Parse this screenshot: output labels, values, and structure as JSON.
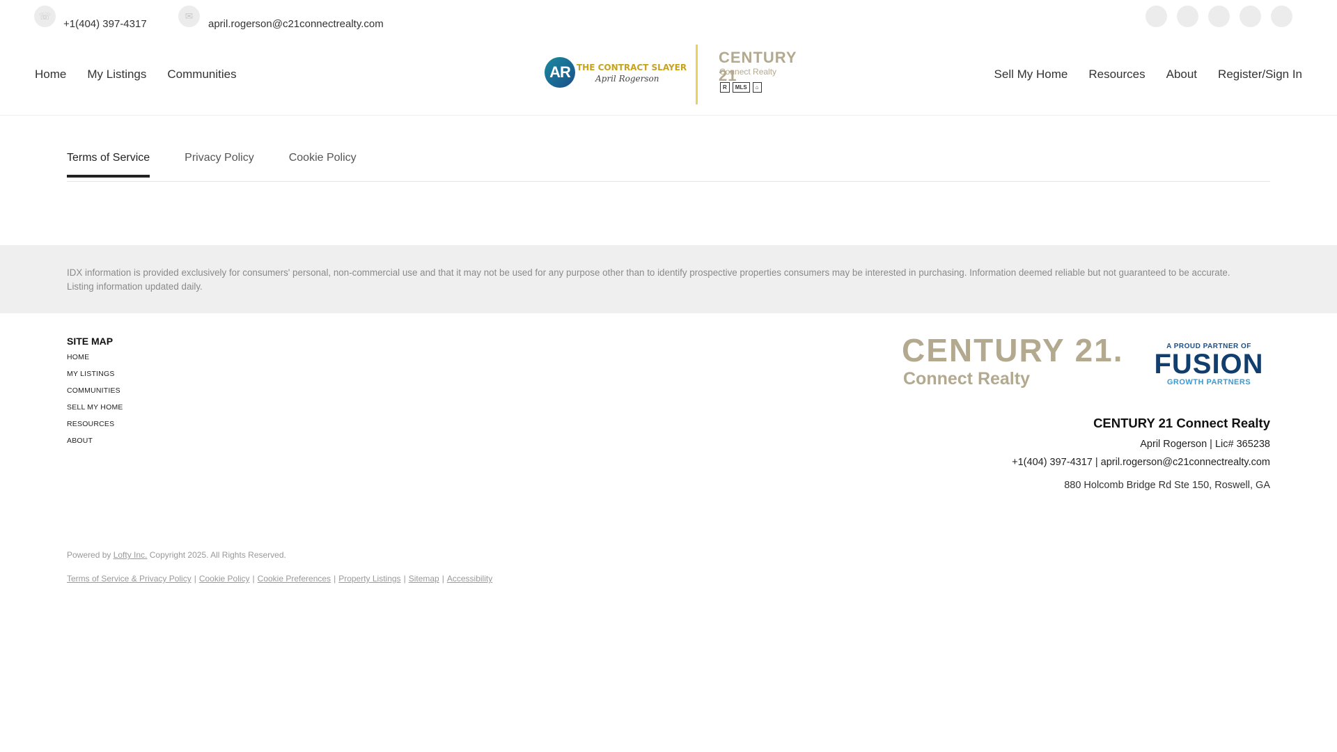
{
  "contact": {
    "phone": "+1(404) 397-4317",
    "email": "april.rogerson@c21connectrealty.com"
  },
  "social_icons": [
    "facebook-icon",
    "instagram-icon",
    "linkedin-icon",
    "youtube-icon",
    "twitter-icon"
  ],
  "nav_left": [
    "Home",
    "My Listings",
    "Communities"
  ],
  "nav_right": [
    "Sell My Home",
    "Resources",
    "About",
    "Register/Sign In"
  ],
  "logo": {
    "ar": "AR",
    "slayer": "THE CONTRACT SLAYER",
    "signature": "April Rogerson",
    "brand": "CENTURY 21",
    "brand_sub": "Connect Realty",
    "badge_r": "R",
    "badge_mls": "MLS",
    "badge_eho": "⌂"
  },
  "tabs": [
    {
      "label": "Terms of Service",
      "active": true
    },
    {
      "label": "Privacy Policy",
      "active": false
    },
    {
      "label": "Cookie Policy",
      "active": false
    }
  ],
  "idx_text": "IDX information is provided exclusively for consumers' personal, non-commercial use and that it may not be used for any purpose other than to identify prospective properties consumers may be interested in purchasing. Information deemed reliable but not guaranteed to be accurate. Listing information updated daily.",
  "sitemap": {
    "title": "SITE MAP",
    "items": [
      "HOME",
      "MY LISTINGS",
      "COMMUNITIES",
      "SELL MY HOME",
      "RESOURCES",
      "ABOUT"
    ]
  },
  "footer_logos": {
    "c21": "CENTURY 21.",
    "c21_sub": "Connect Realty",
    "fusion_top": "A PROUD PARTNER OF",
    "fusion_main": "FUSION",
    "fusion_sub": "GROWTH PARTNERS"
  },
  "office": {
    "name": "CENTURY 21 Connect Realty",
    "agent_line": "April Rogerson  |  Lic# 365238",
    "contact_line": "+1(404) 397-4317  |  april.rogerson@c21connectrealty.com",
    "address": "880 Holcomb Bridge Rd Ste 150, Roswell, GA"
  },
  "powered": {
    "prefix": "Powered by ",
    "link": "Lofty Inc.",
    "suffix": " Copyright 2025. All Rights Reserved."
  },
  "legal_links": [
    "Terms of Service & Privacy Policy",
    "Cookie Policy",
    "Cookie Preferences",
    "Property Listings",
    "Sitemap",
    "Accessibility"
  ],
  "legal_separator": "|"
}
